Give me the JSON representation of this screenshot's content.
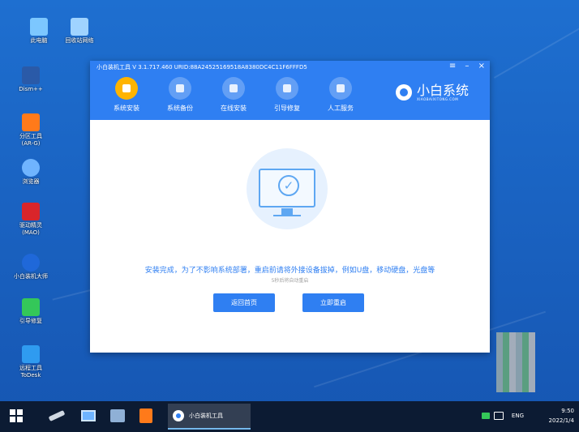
{
  "desktop": {
    "icons": [
      {
        "label": "此电脑",
        "color": "#7cc7ff"
      },
      {
        "label": "回收站网络",
        "color": "#9fd3ff"
      },
      {
        "label": "Dism++",
        "color": "#2a5aa8"
      },
      {
        "label": "分区工具",
        "sublabel": "(AR-G)",
        "color": "#ff7a1a"
      },
      {
        "label": "浏览器",
        "color": "#6fb4ff"
      },
      {
        "label": "驱动精灵",
        "sublabel": "(MAO)",
        "color": "#d9252a"
      },
      {
        "label": "小白装机大师",
        "color": "#1f68d9"
      },
      {
        "label": "引导修复",
        "color": "#34c759"
      },
      {
        "label": "远程工具",
        "sublabel": "ToDesk",
        "color": "#2f9bf0"
      }
    ]
  },
  "window": {
    "title": "小白装机工具 V 3.1.717.460 URID:88A24525169518A8380DC4C11F6FFFD5",
    "controls": {
      "menu": "≡",
      "minimize": "–",
      "close": "×"
    },
    "accent_color": "#2f7ff2",
    "nav": [
      {
        "label": "系统安装",
        "icon": "install-icon",
        "active": true
      },
      {
        "label": "系统备份",
        "icon": "backup-icon"
      },
      {
        "label": "在线安装",
        "icon": "online-install-icon"
      },
      {
        "label": "引导修复",
        "icon": "boot-repair-icon"
      },
      {
        "label": "人工服务",
        "icon": "service-icon"
      }
    ],
    "brand": {
      "name": "小白系统",
      "sub": "XIAOBAIXITONG.COM"
    },
    "content": {
      "message": "安装完成，为了不影响系统部署，重启前请将外接设备拔掉，例如U盘，移动硬盘，光盘等",
      "countdown": "5秒后将自动重启",
      "back_button": "返回首页",
      "restart_button": "立即重启"
    }
  },
  "taskbar": {
    "app_label": "小白装机工具",
    "tray_lang": "ENG",
    "time": "9:50",
    "date": "2022/1/4"
  }
}
